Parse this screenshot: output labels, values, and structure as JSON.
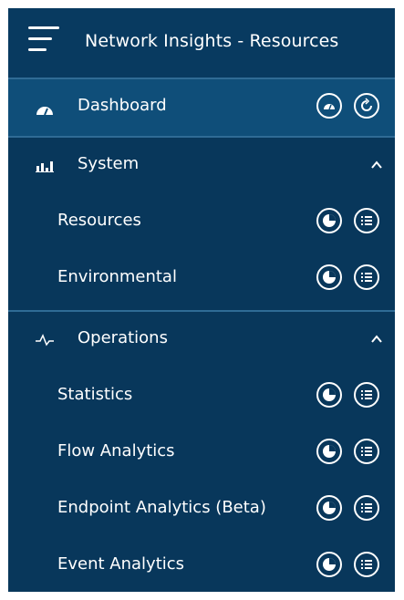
{
  "header": {
    "title": "Network Insights - Resources",
    "menu_icon": "hamburger-icon"
  },
  "dashboard": {
    "label": "Dashboard",
    "icon": "dashboard-gauge-icon",
    "actions": [
      "dashboard-icon",
      "refresh-icon"
    ]
  },
  "system": {
    "label": "System",
    "icon": "bar-chart-icon",
    "expanded": true,
    "items": [
      {
        "label": "Resources"
      },
      {
        "label": "Environmental"
      }
    ]
  },
  "operations": {
    "label": "Operations",
    "icon": "pulse-icon",
    "expanded": true,
    "items": [
      {
        "label": "Statistics"
      },
      {
        "label": "Flow Analytics"
      },
      {
        "label": "Endpoint Analytics (Beta)"
      },
      {
        "label": "Event Analytics"
      }
    ]
  },
  "item_actions": [
    "pie-chart-icon",
    "list-icon"
  ],
  "colors": {
    "background": "#08375b",
    "header": "#083a60",
    "active": "#0f4e79",
    "divider": "#2f6b95"
  }
}
